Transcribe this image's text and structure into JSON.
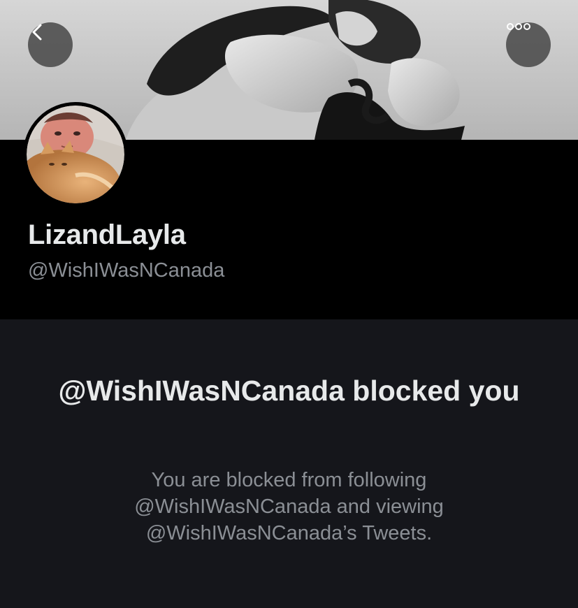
{
  "header": {
    "back_icon": "chevron-left-icon",
    "more_icon": "more-horizontal-icon",
    "banner_image": "black-and-white photo of two people embracing"
  },
  "profile": {
    "display_name": "LizandLayla",
    "handle": "@WishIWasNCanada",
    "avatar": "photo of a person lying with an orange cat"
  },
  "blocked": {
    "title": "@WishIWasNCanada blocked you",
    "message": "You are blocked from following @WishIWasNCanada and viewing @WishIWasNCanada’s Tweets."
  },
  "colors": {
    "profile_bg": "#000000",
    "notice_bg": "#15161b",
    "primary_text": "#e7e9ea",
    "secondary_text": "#8b8f95",
    "button_bg": "#464646"
  }
}
